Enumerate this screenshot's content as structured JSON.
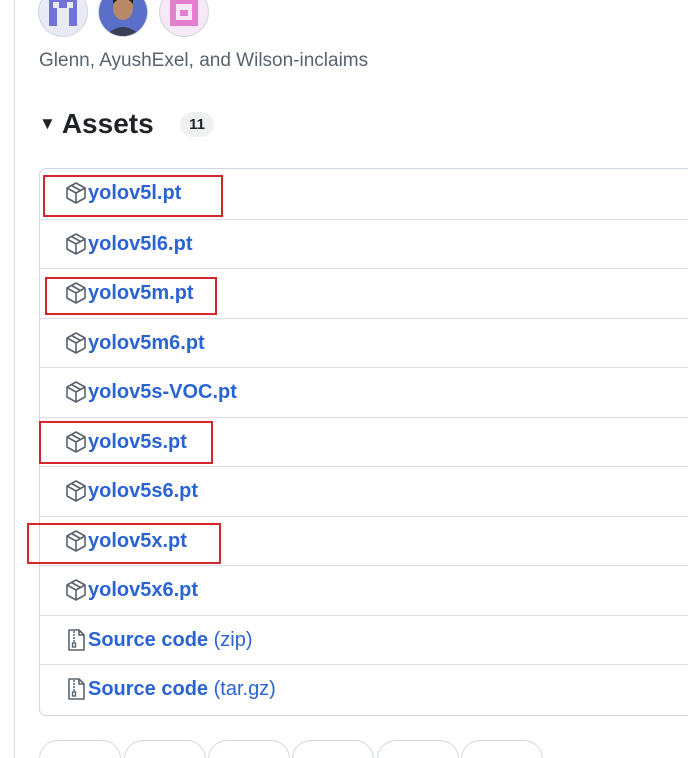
{
  "contributors": {
    "text": "Glenn, AyushExel, and Wilson-inclaims",
    "avatars": [
      "avatar-identicon-blue",
      "avatar-photo",
      "avatar-identicon-pink"
    ]
  },
  "assets": {
    "title": "Assets",
    "count": "11",
    "items": [
      {
        "name": "yolov5l.pt",
        "icon": "package-icon",
        "highlighted": true
      },
      {
        "name": "yolov5l6.pt",
        "icon": "package-icon",
        "highlighted": false
      },
      {
        "name": "yolov5m.pt",
        "icon": "package-icon",
        "highlighted": true
      },
      {
        "name": "yolov5m6.pt",
        "icon": "package-icon",
        "highlighted": false
      },
      {
        "name": "yolov5s-VOC.pt",
        "icon": "package-icon",
        "highlighted": false
      },
      {
        "name": "yolov5s.pt",
        "icon": "package-icon",
        "highlighted": true
      },
      {
        "name": "yolov5s6.pt",
        "icon": "package-icon",
        "highlighted": false
      },
      {
        "name": "yolov5x.pt",
        "icon": "package-icon",
        "highlighted": true
      },
      {
        "name": "yolov5x6.pt",
        "icon": "package-icon",
        "highlighted": false
      },
      {
        "name": "Source code",
        "ext": "(zip)",
        "icon": "file-zip-icon",
        "highlighted": false
      },
      {
        "name": "Source code",
        "ext": "(tar.gz)",
        "icon": "file-zip-icon",
        "highlighted": false
      }
    ]
  },
  "colors": {
    "link": "#2a63d3",
    "highlight_box": "#d3272b",
    "border": "#d0d7de"
  }
}
